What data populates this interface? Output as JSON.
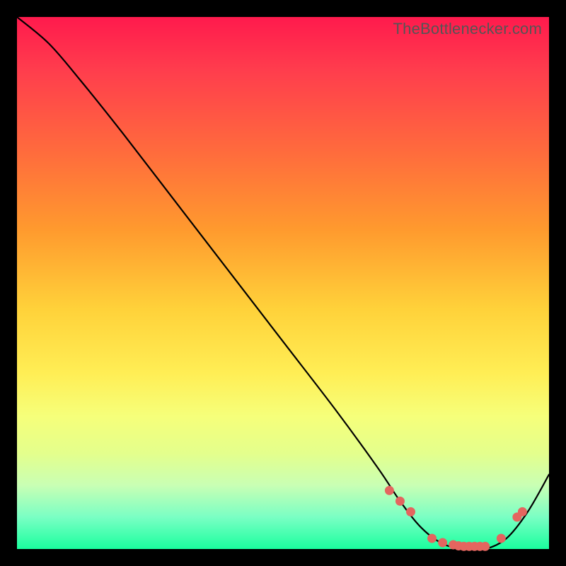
{
  "watermark": "TheBottlenecker.com",
  "chart_data": {
    "type": "line",
    "title": "",
    "xlabel": "",
    "ylabel": "",
    "xlim": [
      0,
      100
    ],
    "ylim": [
      0,
      100
    ],
    "series": [
      {
        "name": "bottleneck-curve",
        "x": [
          0,
          6,
          12,
          20,
          30,
          40,
          50,
          60,
          68,
          72,
          76,
          80,
          84,
          88,
          92,
          96,
          100
        ],
        "y": [
          100,
          95,
          88,
          78,
          65,
          52,
          39,
          26,
          15,
          9,
          4,
          1,
          0,
          0,
          2,
          7,
          14
        ]
      }
    ],
    "markers": {
      "name": "highlight-dots",
      "x": [
        70,
        72,
        74,
        78,
        80,
        82,
        83,
        84,
        85,
        86,
        87,
        88,
        91,
        94,
        95
      ],
      "y": [
        11,
        9,
        7,
        2,
        1.2,
        0.8,
        0.6,
        0.5,
        0.5,
        0.5,
        0.5,
        0.5,
        2,
        6,
        7
      ]
    }
  }
}
